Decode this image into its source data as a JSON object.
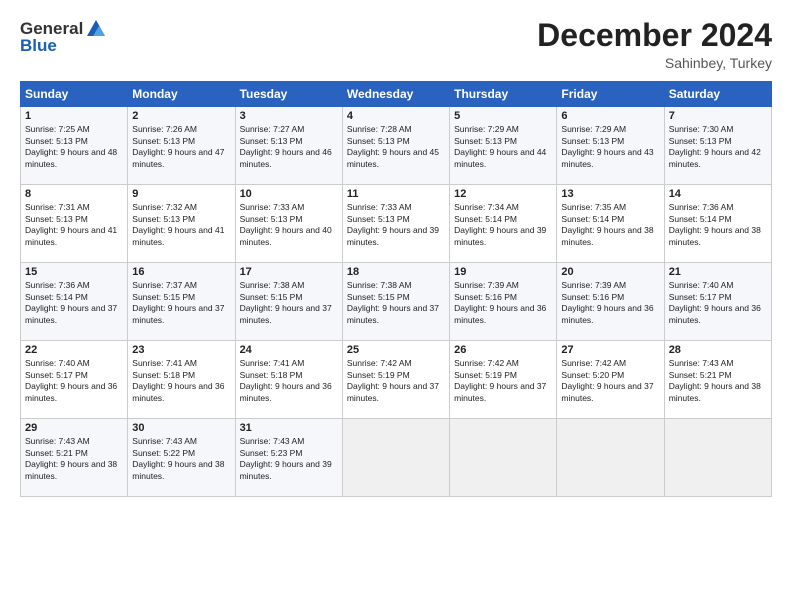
{
  "header": {
    "logo_general": "General",
    "logo_blue": "Blue",
    "month_title": "December 2024",
    "location": "Sahinbey, Turkey"
  },
  "weekdays": [
    "Sunday",
    "Monday",
    "Tuesday",
    "Wednesday",
    "Thursday",
    "Friday",
    "Saturday"
  ],
  "weeks": [
    [
      {
        "day": "1",
        "sunrise": "Sunrise: 7:25 AM",
        "sunset": "Sunset: 5:13 PM",
        "daylight": "Daylight: 9 hours and 48 minutes."
      },
      {
        "day": "2",
        "sunrise": "Sunrise: 7:26 AM",
        "sunset": "Sunset: 5:13 PM",
        "daylight": "Daylight: 9 hours and 47 minutes."
      },
      {
        "day": "3",
        "sunrise": "Sunrise: 7:27 AM",
        "sunset": "Sunset: 5:13 PM",
        "daylight": "Daylight: 9 hours and 46 minutes."
      },
      {
        "day": "4",
        "sunrise": "Sunrise: 7:28 AM",
        "sunset": "Sunset: 5:13 PM",
        "daylight": "Daylight: 9 hours and 45 minutes."
      },
      {
        "day": "5",
        "sunrise": "Sunrise: 7:29 AM",
        "sunset": "Sunset: 5:13 PM",
        "daylight": "Daylight: 9 hours and 44 minutes."
      },
      {
        "day": "6",
        "sunrise": "Sunrise: 7:29 AM",
        "sunset": "Sunset: 5:13 PM",
        "daylight": "Daylight: 9 hours and 43 minutes."
      },
      {
        "day": "7",
        "sunrise": "Sunrise: 7:30 AM",
        "sunset": "Sunset: 5:13 PM",
        "daylight": "Daylight: 9 hours and 42 minutes."
      }
    ],
    [
      {
        "day": "8",
        "sunrise": "Sunrise: 7:31 AM",
        "sunset": "Sunset: 5:13 PM",
        "daylight": "Daylight: 9 hours and 41 minutes."
      },
      {
        "day": "9",
        "sunrise": "Sunrise: 7:32 AM",
        "sunset": "Sunset: 5:13 PM",
        "daylight": "Daylight: 9 hours and 41 minutes."
      },
      {
        "day": "10",
        "sunrise": "Sunrise: 7:33 AM",
        "sunset": "Sunset: 5:13 PM",
        "daylight": "Daylight: 9 hours and 40 minutes."
      },
      {
        "day": "11",
        "sunrise": "Sunrise: 7:33 AM",
        "sunset": "Sunset: 5:13 PM",
        "daylight": "Daylight: 9 hours and 39 minutes."
      },
      {
        "day": "12",
        "sunrise": "Sunrise: 7:34 AM",
        "sunset": "Sunset: 5:14 PM",
        "daylight": "Daylight: 9 hours and 39 minutes."
      },
      {
        "day": "13",
        "sunrise": "Sunrise: 7:35 AM",
        "sunset": "Sunset: 5:14 PM",
        "daylight": "Daylight: 9 hours and 38 minutes."
      },
      {
        "day": "14",
        "sunrise": "Sunrise: 7:36 AM",
        "sunset": "Sunset: 5:14 PM",
        "daylight": "Daylight: 9 hours and 38 minutes."
      }
    ],
    [
      {
        "day": "15",
        "sunrise": "Sunrise: 7:36 AM",
        "sunset": "Sunset: 5:14 PM",
        "daylight": "Daylight: 9 hours and 37 minutes."
      },
      {
        "day": "16",
        "sunrise": "Sunrise: 7:37 AM",
        "sunset": "Sunset: 5:15 PM",
        "daylight": "Daylight: 9 hours and 37 minutes."
      },
      {
        "day": "17",
        "sunrise": "Sunrise: 7:38 AM",
        "sunset": "Sunset: 5:15 PM",
        "daylight": "Daylight: 9 hours and 37 minutes."
      },
      {
        "day": "18",
        "sunrise": "Sunrise: 7:38 AM",
        "sunset": "Sunset: 5:15 PM",
        "daylight": "Daylight: 9 hours and 37 minutes."
      },
      {
        "day": "19",
        "sunrise": "Sunrise: 7:39 AM",
        "sunset": "Sunset: 5:16 PM",
        "daylight": "Daylight: 9 hours and 36 minutes."
      },
      {
        "day": "20",
        "sunrise": "Sunrise: 7:39 AM",
        "sunset": "Sunset: 5:16 PM",
        "daylight": "Daylight: 9 hours and 36 minutes."
      },
      {
        "day": "21",
        "sunrise": "Sunrise: 7:40 AM",
        "sunset": "Sunset: 5:17 PM",
        "daylight": "Daylight: 9 hours and 36 minutes."
      }
    ],
    [
      {
        "day": "22",
        "sunrise": "Sunrise: 7:40 AM",
        "sunset": "Sunset: 5:17 PM",
        "daylight": "Daylight: 9 hours and 36 minutes."
      },
      {
        "day": "23",
        "sunrise": "Sunrise: 7:41 AM",
        "sunset": "Sunset: 5:18 PM",
        "daylight": "Daylight: 9 hours and 36 minutes."
      },
      {
        "day": "24",
        "sunrise": "Sunrise: 7:41 AM",
        "sunset": "Sunset: 5:18 PM",
        "daylight": "Daylight: 9 hours and 36 minutes."
      },
      {
        "day": "25",
        "sunrise": "Sunrise: 7:42 AM",
        "sunset": "Sunset: 5:19 PM",
        "daylight": "Daylight: 9 hours and 37 minutes."
      },
      {
        "day": "26",
        "sunrise": "Sunrise: 7:42 AM",
        "sunset": "Sunset: 5:19 PM",
        "daylight": "Daylight: 9 hours and 37 minutes."
      },
      {
        "day": "27",
        "sunrise": "Sunrise: 7:42 AM",
        "sunset": "Sunset: 5:20 PM",
        "daylight": "Daylight: 9 hours and 37 minutes."
      },
      {
        "day": "28",
        "sunrise": "Sunrise: 7:43 AM",
        "sunset": "Sunset: 5:21 PM",
        "daylight": "Daylight: 9 hours and 38 minutes."
      }
    ],
    [
      {
        "day": "29",
        "sunrise": "Sunrise: 7:43 AM",
        "sunset": "Sunset: 5:21 PM",
        "daylight": "Daylight: 9 hours and 38 minutes."
      },
      {
        "day": "30",
        "sunrise": "Sunrise: 7:43 AM",
        "sunset": "Sunset: 5:22 PM",
        "daylight": "Daylight: 9 hours and 38 minutes."
      },
      {
        "day": "31",
        "sunrise": "Sunrise: 7:43 AM",
        "sunset": "Sunset: 5:23 PM",
        "daylight": "Daylight: 9 hours and 39 minutes."
      },
      null,
      null,
      null,
      null
    ]
  ]
}
